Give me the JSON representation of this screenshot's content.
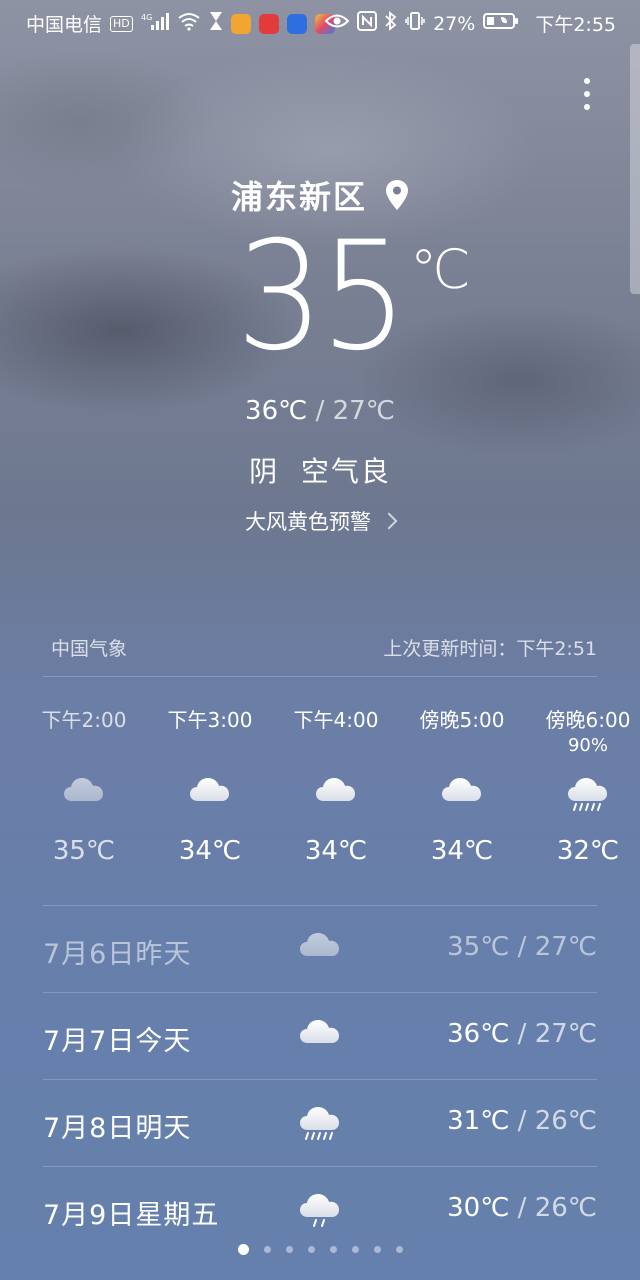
{
  "status_bar": {
    "carrier": "中国电信",
    "hd": "HD",
    "network": "4G",
    "battery": "27%",
    "time": "下午2:55"
  },
  "location": {
    "city": "浦东新区",
    "icon": "location-pin-icon"
  },
  "current": {
    "temperature": "35",
    "unit": "℃",
    "high": "36℃",
    "separator": "/",
    "low": "27℃",
    "condition": "阴  空气良",
    "warning": "大风黄色预警"
  },
  "source": {
    "provider": "中国气象",
    "updated": "上次更新时间：下午2:51"
  },
  "hourly": [
    {
      "time": "下午2:00",
      "precip": "",
      "icon": "cloudy-icon",
      "temp": "35℃",
      "past": true
    },
    {
      "time": "下午3:00",
      "precip": "",
      "icon": "cloudy-icon",
      "temp": "34℃",
      "past": false
    },
    {
      "time": "下午4:00",
      "precip": "",
      "icon": "cloudy-icon",
      "temp": "34℃",
      "past": false
    },
    {
      "time": "傍晚5:00",
      "precip": "",
      "icon": "cloudy-icon",
      "temp": "34℃",
      "past": false
    },
    {
      "time": "傍晚6:00",
      "precip": "90%",
      "icon": "rain-icon",
      "temp": "32℃",
      "past": false
    }
  ],
  "daily": [
    {
      "date": "7月6日昨天",
      "icon": "cloudy-icon",
      "high": "35℃",
      "separator": "/",
      "low": "27℃",
      "past": true
    },
    {
      "date": "7月7日今天",
      "icon": "cloudy-icon",
      "high": "36℃",
      "separator": "/",
      "low": "27℃",
      "past": false
    },
    {
      "date": "7月8日明天",
      "icon": "rain-icon",
      "high": "31℃",
      "separator": "/",
      "low": "26℃",
      "past": false
    },
    {
      "date": "7月9日星期五",
      "icon": "light-rain-icon",
      "high": "30℃",
      "separator": "/",
      "low": "26℃",
      "past": false
    }
  ],
  "pager": {
    "total": 8,
    "active": 0
  }
}
